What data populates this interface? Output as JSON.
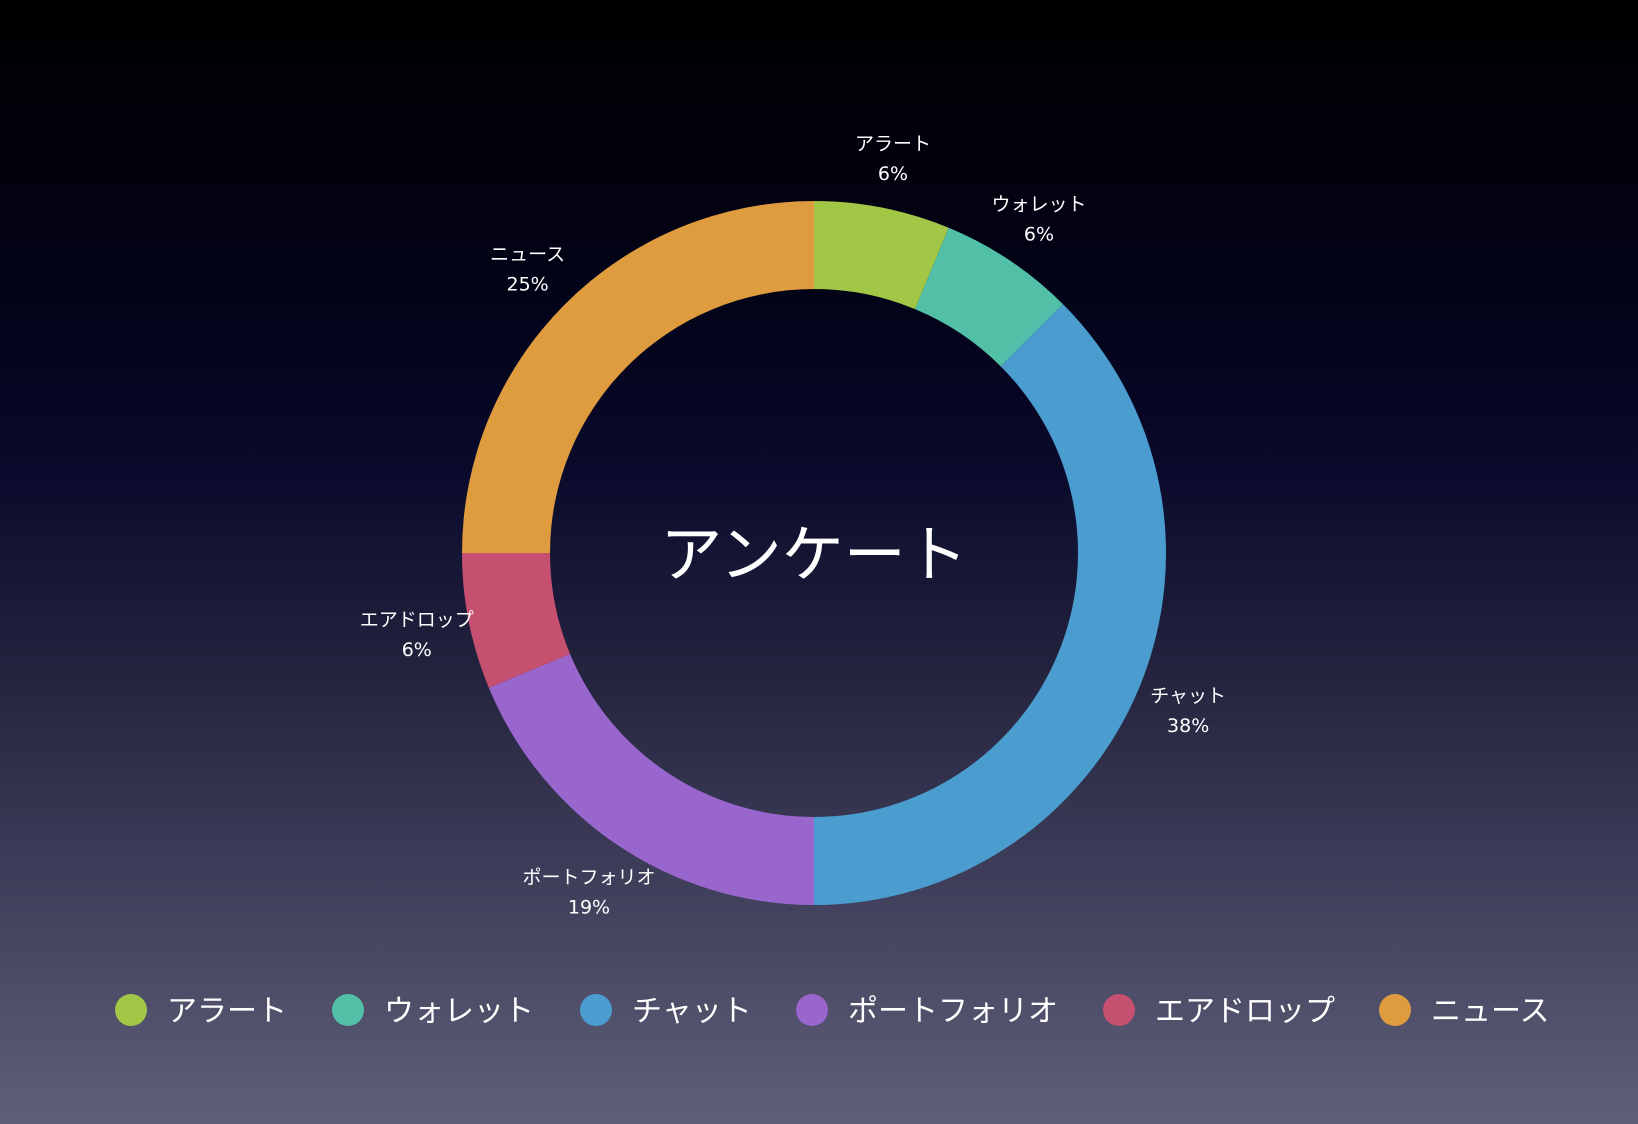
{
  "chart_data": {
    "type": "pie",
    "variant": "donut",
    "title": "アンケート",
    "categories": [
      "アラート",
      "ウォレット",
      "チャット",
      "ポートフォリオ",
      "エアドロップ",
      "ニュース"
    ],
    "values": [
      6.25,
      6.25,
      37.5,
      18.75,
      6.25,
      25
    ],
    "value_labels": [
      "6%",
      "6%",
      "38%",
      "19%",
      "6%",
      "25%"
    ],
    "colors": [
      "#a2c645",
      "#52c0a6",
      "#4b9dcf",
      "#9866cc",
      "#c6506f",
      "#df9c3e"
    ],
    "legend": {
      "position": "bottom",
      "items": [
        "アラート",
        "ウォレット",
        "チャット",
        "ポートフォリオ",
        "エアドロップ",
        "ニュース"
      ]
    }
  }
}
